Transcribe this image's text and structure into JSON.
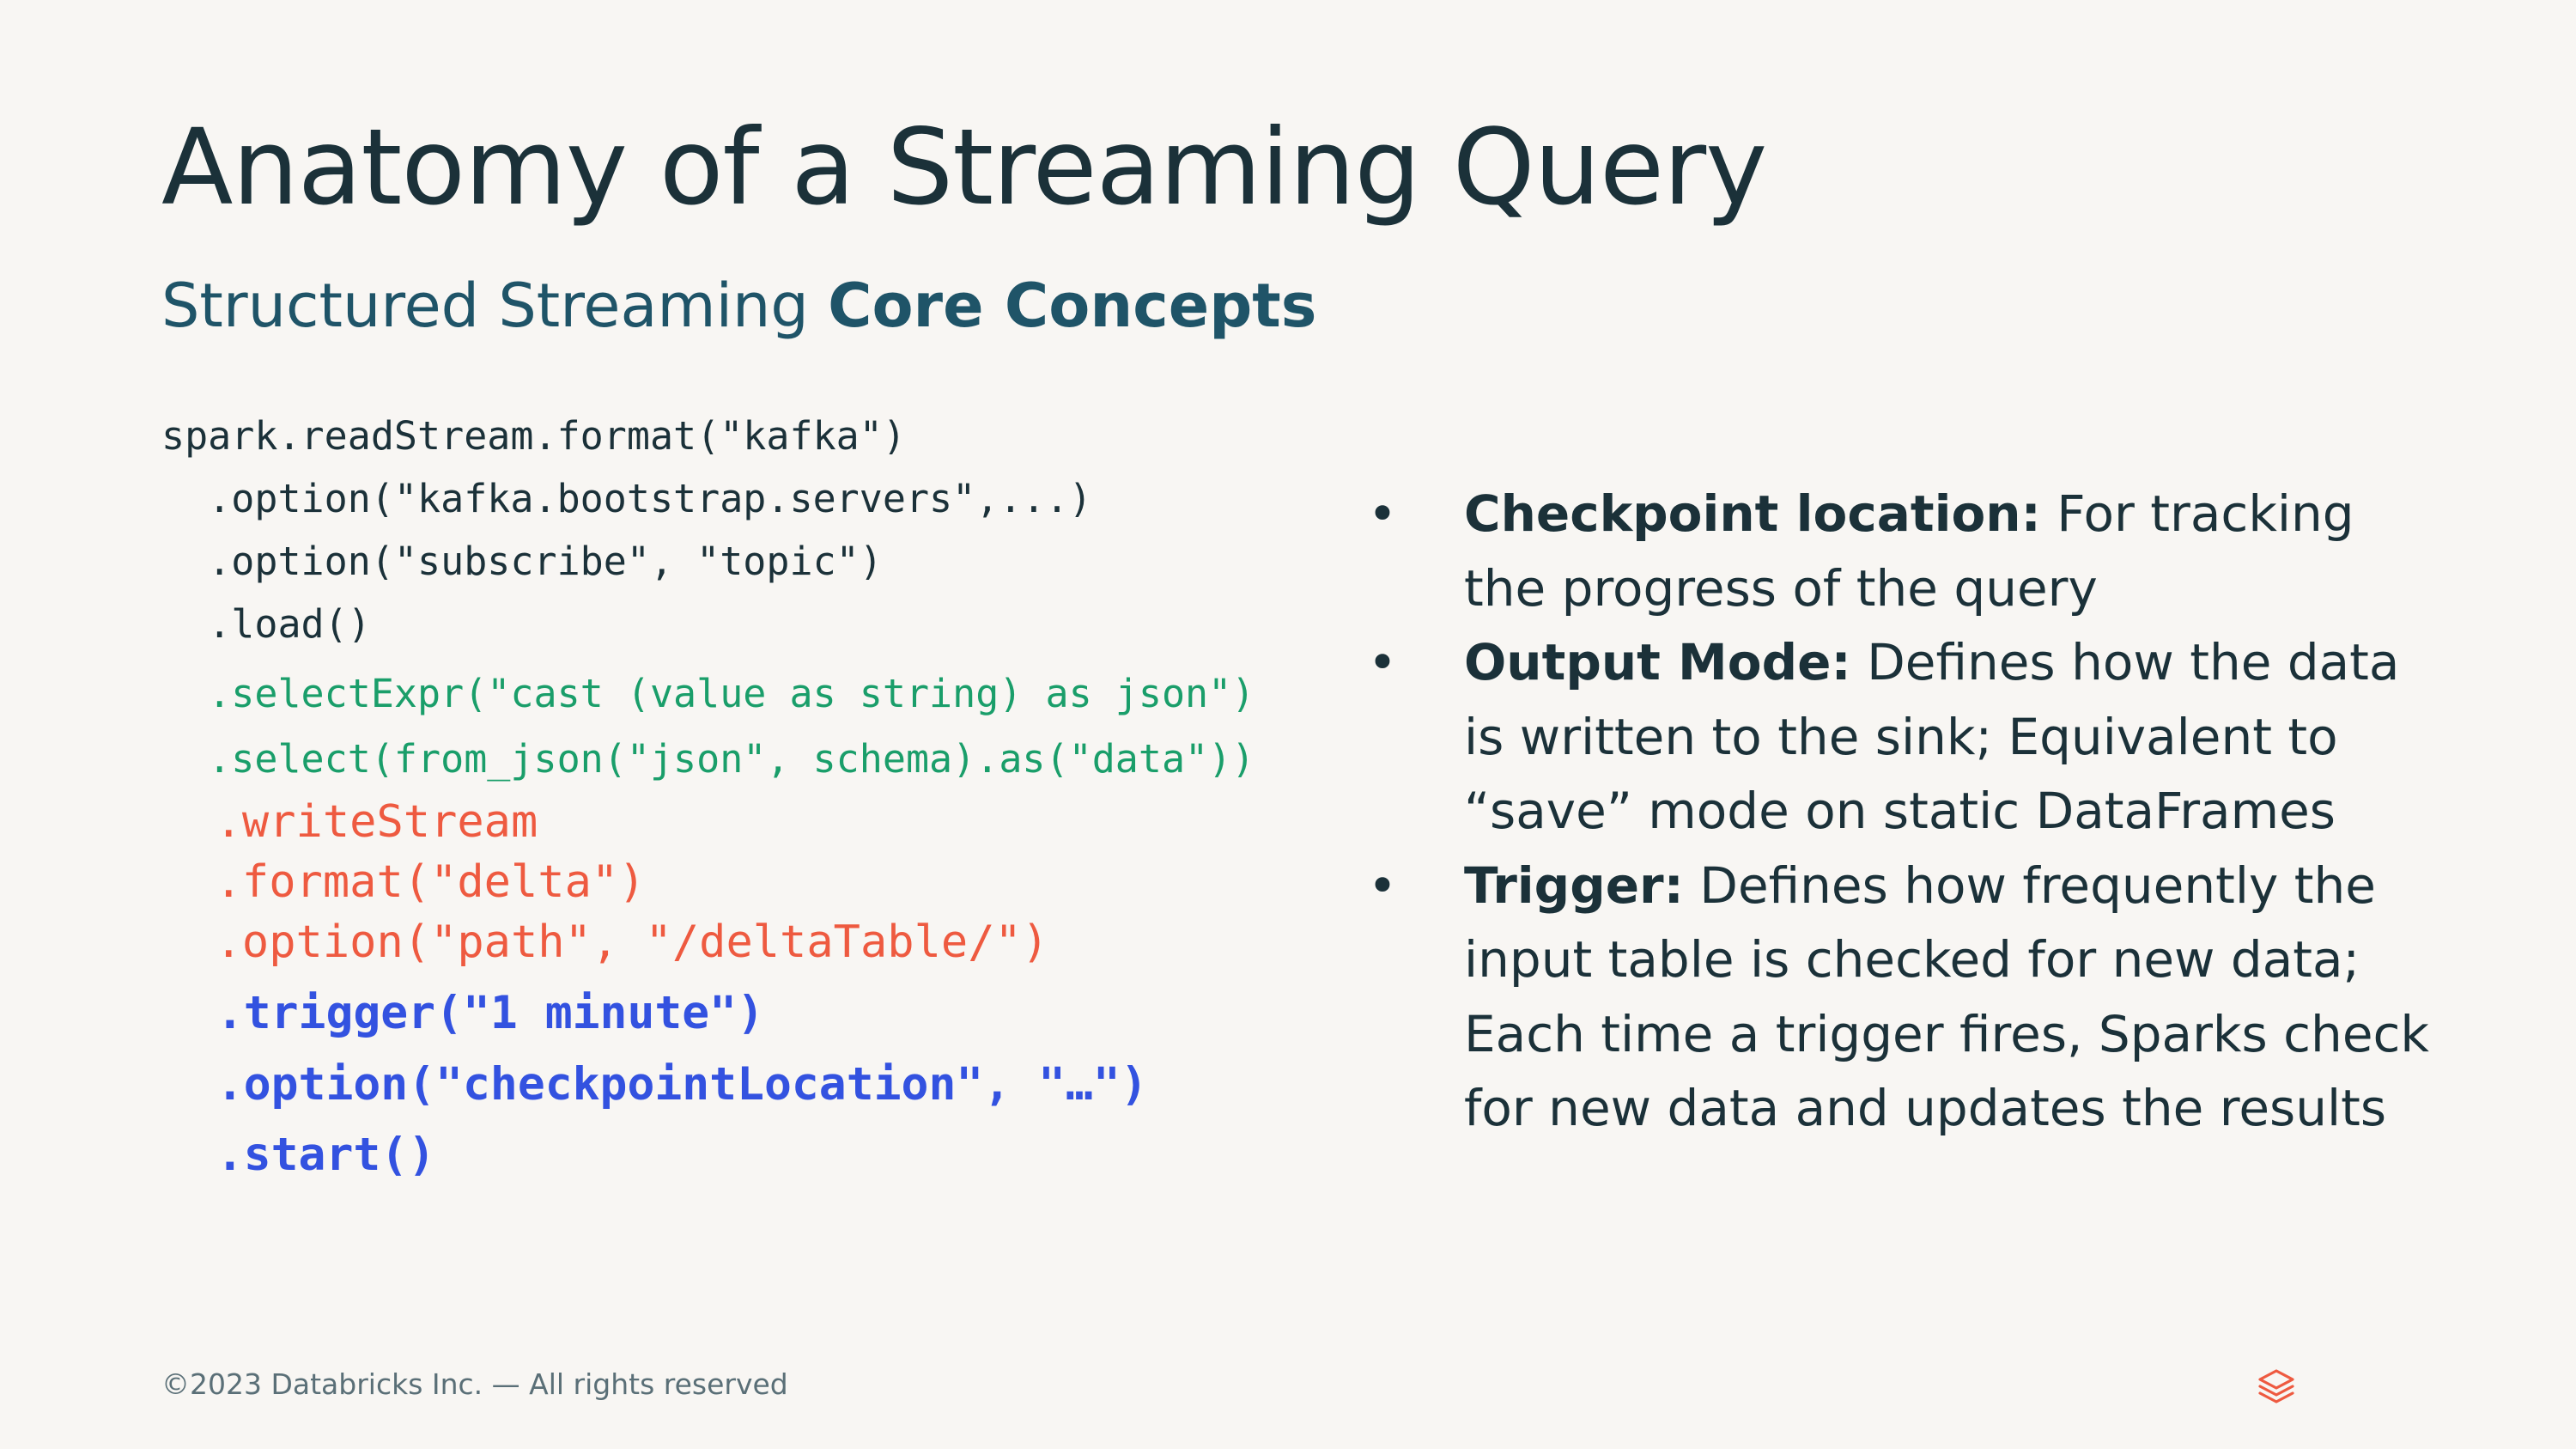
{
  "slide": {
    "title": "Anatomy of a Streaming Query",
    "subtitle_regular": "Structured Streaming ",
    "subtitle_bold": "Core Concepts"
  },
  "code": {
    "lines": [
      "spark.readStream.format(\"kafka\")",
      "  .option(\"kafka.bootstrap.servers\",...)",
      "  .option(\"subscribe\", \"topic\")",
      "  .load()",
      "  .selectExpr(\"cast (value as string) as json\")",
      "  .select(from_json(\"json\", schema).as(\"data\"))",
      "  .writeStream",
      "  .format(\"delta\")",
      "  .option(\"path\", \"/deltaTable/\")",
      "  .trigger(\"1 minute\")",
      "  .option(\"checkpointLocation\", \"…\")",
      "  .start()"
    ]
  },
  "bullets": [
    {
      "marker": "•",
      "term": "Checkpoint location:",
      "text": " For tracking the progress of the query"
    },
    {
      "marker": "•",
      "term": "Output Mode:",
      "text": " Defines how the data is written to the sink; Equivalent to “save” mode on static DataFrames"
    },
    {
      "marker": "•",
      "term": "Trigger:",
      "text": " Defines how frequently the input table is checked for new data; Each time a trigger fires, Sparks check for new data and updates the results"
    }
  ],
  "footer": {
    "copyright": "©2023 Databricks Inc. — All rights reserved",
    "logo_icon": "databricks-logo-icon"
  },
  "colors": {
    "background": "#F8F6F3",
    "title": "#1B3139",
    "subtitle": "#1F5468",
    "code_dark": "#1B3139",
    "code_green": "#1A9E6A",
    "code_red": "#EE5A40",
    "code_blue": "#3352E0",
    "logo": "#EE5A40"
  }
}
